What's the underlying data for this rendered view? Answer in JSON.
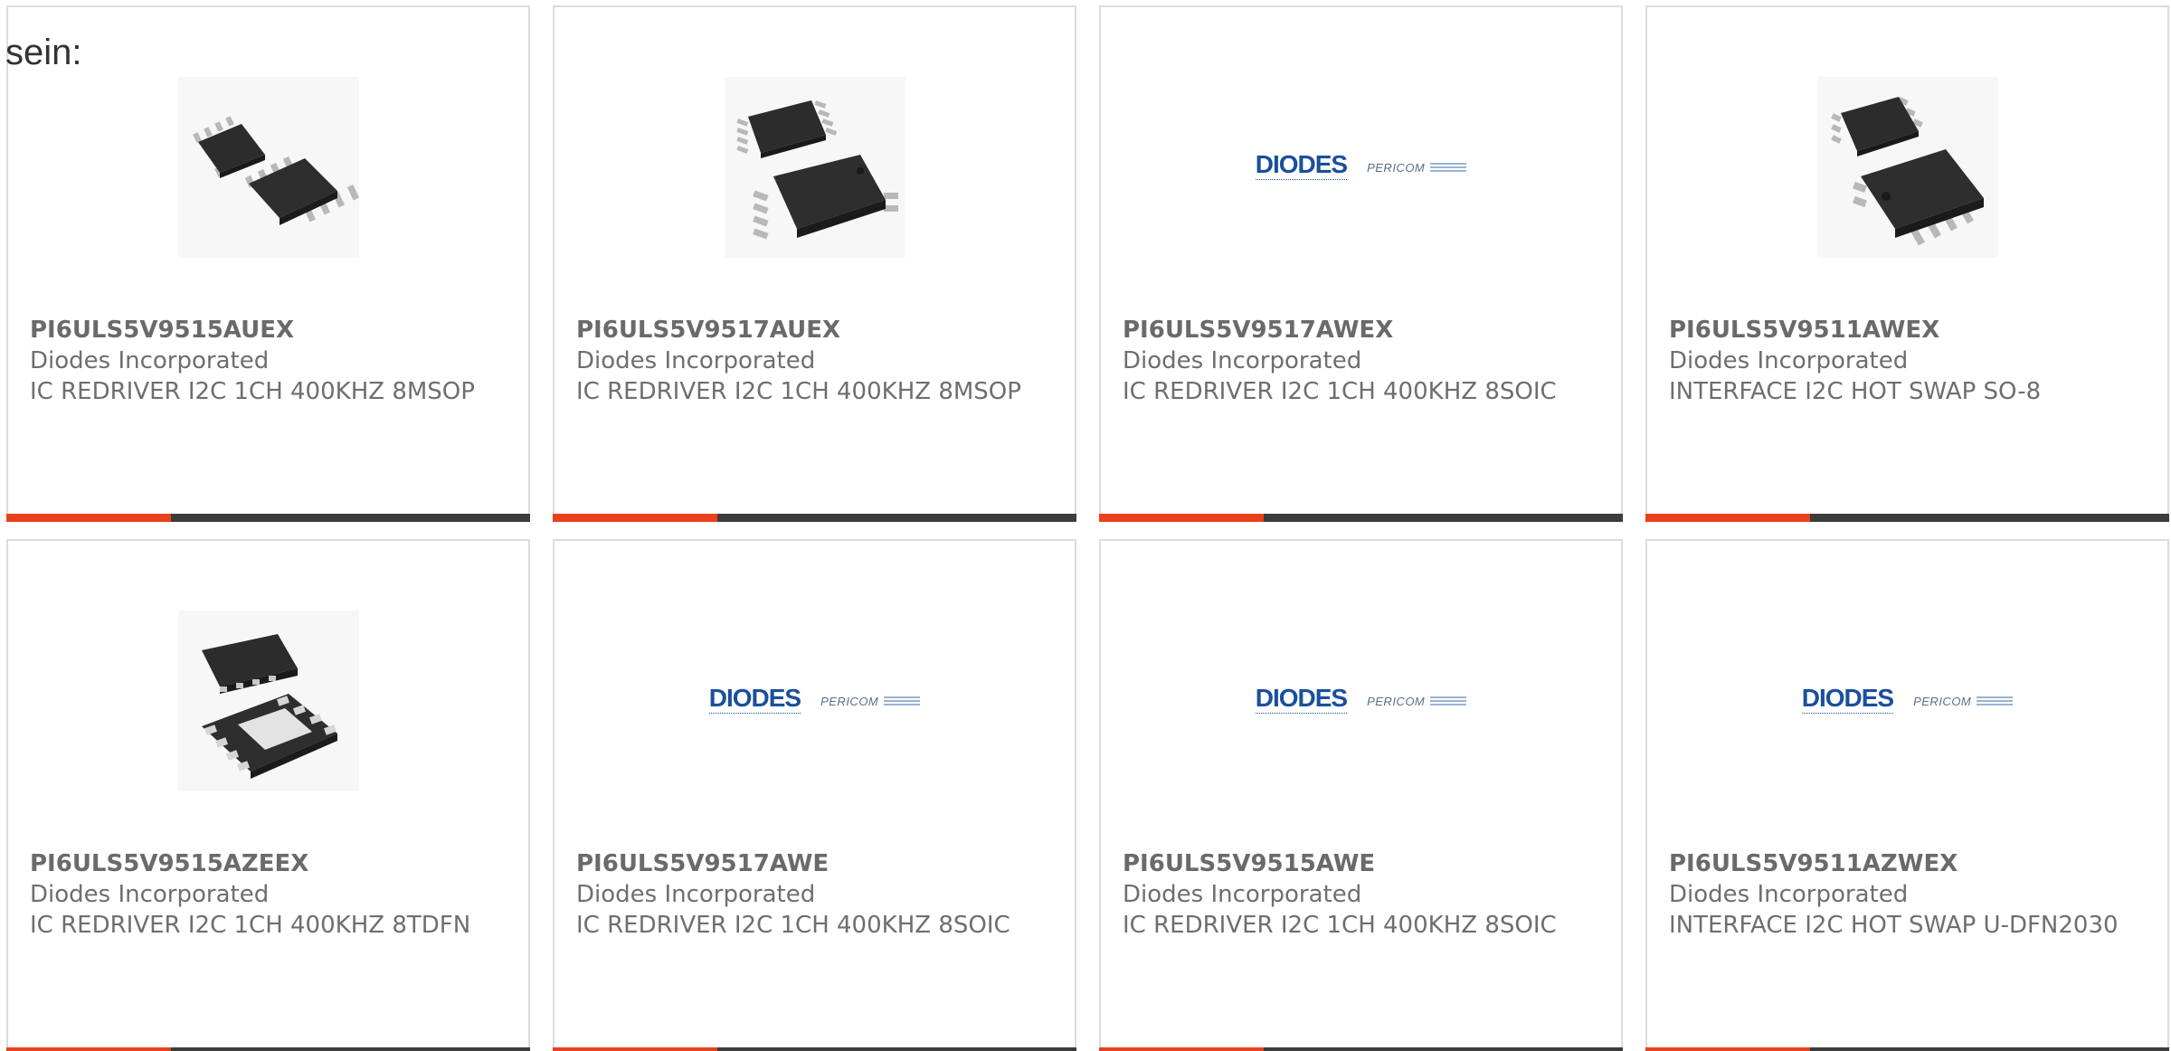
{
  "intro_text": "sein:",
  "colors": {
    "accent": "#e9411b",
    "bar": "#3c3c3c",
    "logo_blue": "#1a4f9c"
  },
  "cards": [
    {
      "part": "PI6ULS5V9515AUEX",
      "manufacturer": "Diodes Incorporated",
      "description": "IC REDRIVER I2C 1CH 400KHZ 8MSOP",
      "image": "msop-8-package"
    },
    {
      "part": "PI6ULS5V9517AUEX",
      "manufacturer": "Diodes Incorporated",
      "description": "IC REDRIVER I2C 1CH 400KHZ 8MSOP",
      "image": "msop-8-package"
    },
    {
      "part": "PI6ULS5V9517AWEX",
      "manufacturer": "Diodes Incorporated",
      "description": "IC REDRIVER I2C 1CH 400KHZ 8SOIC",
      "image": "diodes-pericom-logo"
    },
    {
      "part": "PI6ULS5V9511AWEX",
      "manufacturer": "Diodes Incorporated",
      "description": "INTERFACE I2C HOT SWAP SO-8",
      "image": "soic-8-package"
    },
    {
      "part": "PI6ULS5V9515AZEEX",
      "manufacturer": "Diodes Incorporated",
      "description": "IC REDRIVER I2C 1CH 400KHZ 8TDFN",
      "image": "tdfn-8-package"
    },
    {
      "part": "PI6ULS5V9517AWE",
      "manufacturer": "Diodes Incorporated",
      "description": "IC REDRIVER I2C 1CH 400KHZ 8SOIC",
      "image": "diodes-pericom-logo"
    },
    {
      "part": "PI6ULS5V9515AWE",
      "manufacturer": "Diodes Incorporated",
      "description": "IC REDRIVER I2C 1CH 400KHZ 8SOIC",
      "image": "diodes-pericom-logo"
    },
    {
      "part": "PI6ULS5V9511AZWEX",
      "manufacturer": "Diodes Incorporated",
      "description": "INTERFACE I2C HOT SWAP U-DFN2030",
      "image": "diodes-pericom-logo"
    }
  ],
  "logo": {
    "brand": "DIODES",
    "sub": "PERICOM"
  }
}
